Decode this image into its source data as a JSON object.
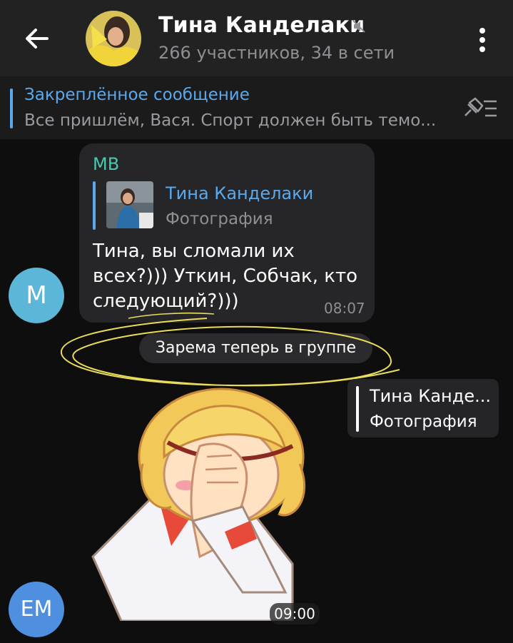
{
  "header": {
    "title": "Тина Канделаки",
    "subtitle": "266 участников, 34 в сети"
  },
  "pinned": {
    "label": "Закреплённое сообщение",
    "text": "Все пришлём, Вася. Спорт должен быть темо..."
  },
  "message1": {
    "avatar_initials": "M",
    "sender": "MB",
    "reply": {
      "name": "Тина Канделаки",
      "type": "Фотография"
    },
    "lines": [
      "Тина, вы сломали их",
      "всех?))) Уткин, Собчак, кто",
      "следующий?)))"
    ],
    "time": "08:07"
  },
  "service_message": "Зарема теперь в группе",
  "message2": {
    "avatar_initials": "EM",
    "reply": {
      "name": "Тина Канде...",
      "type": "Фотография"
    },
    "time": "09:00"
  },
  "colors": {
    "accent": "#5aa9ef",
    "sender_name": "#48c9b0",
    "highlight_scribble": "#e8dc5a"
  }
}
